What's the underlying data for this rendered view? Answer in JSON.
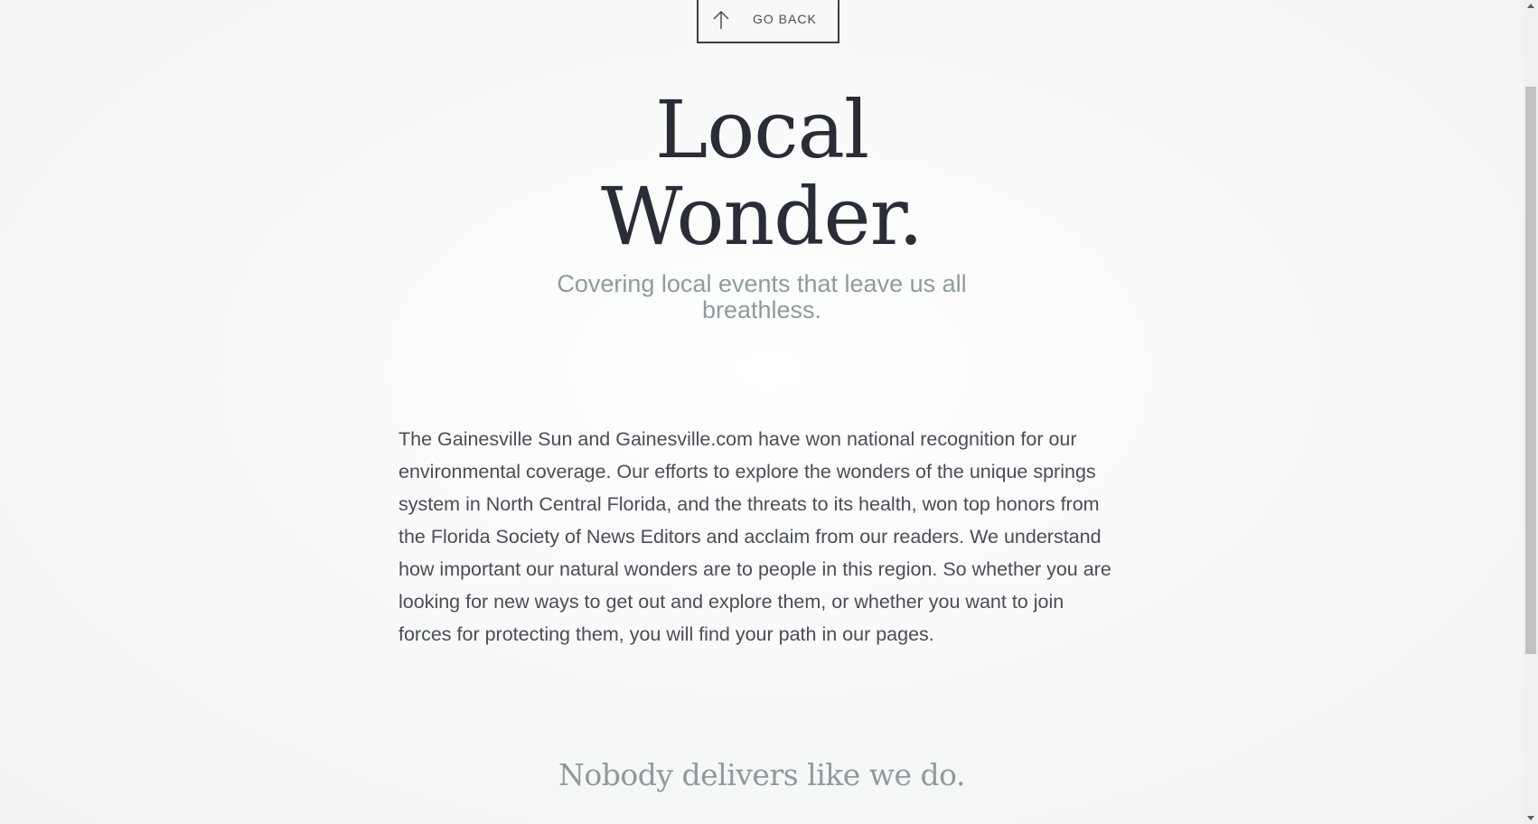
{
  "nav": {
    "go_back_label": "GO BACK",
    "go_back_icon": "arrow-up-icon"
  },
  "hero": {
    "title_line1": "Local",
    "title_line2": "Wonder.",
    "subtitle": "Covering local events that leave us all breathless."
  },
  "main": {
    "body": "The Gainesville Sun and Gainesville.com have won national recognition for our environmental coverage. Our efforts to explore the wonders of the unique springs system in North Central Florida, and the threats to its health, won top honors from the Florida Society of News Editors and acclaim from our readers. We understand how important our natural wonders are to people in this region. So whether you are looking for new ways to get out and explore them, or whether you want to join forces for protecting them, you will find your path in our pages.",
    "section_heading": "Nobody delivers like we do."
  },
  "colors": {
    "title": "#2a2c38",
    "muted": "#8e9b9c",
    "body": "#4a4d55"
  }
}
